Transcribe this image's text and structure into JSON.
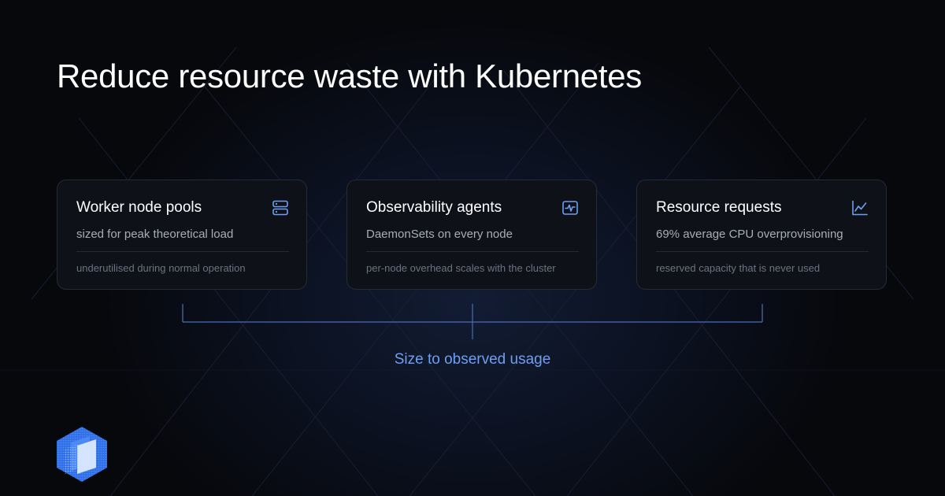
{
  "title": "Reduce resource waste with Kubernetes",
  "cards": [
    {
      "title": "Worker node pools",
      "subtitle": "sized for peak theoretical load",
      "note": "underutilised during normal operation",
      "icon": "server-icon"
    },
    {
      "title": "Observability agents",
      "subtitle": "DaemonSets on every node",
      "note": "per-node overhead scales with the cluster",
      "icon": "activity-monitor-icon"
    },
    {
      "title": "Resource requests",
      "subtitle": "69% average CPU overprovisioning",
      "note": "reserved capacity that is never used",
      "icon": "line-chart-icon"
    }
  ],
  "bracket": {
    "label": "Size to observed usage"
  },
  "colors": {
    "background": "#07080c",
    "card_background": "#0f1119",
    "card_border": "#262a36",
    "accent": "#6f9ff2",
    "bracket_line": "#4a6fb0",
    "subtitle_text": "#a9adb8",
    "note_text": "#6d7280"
  }
}
